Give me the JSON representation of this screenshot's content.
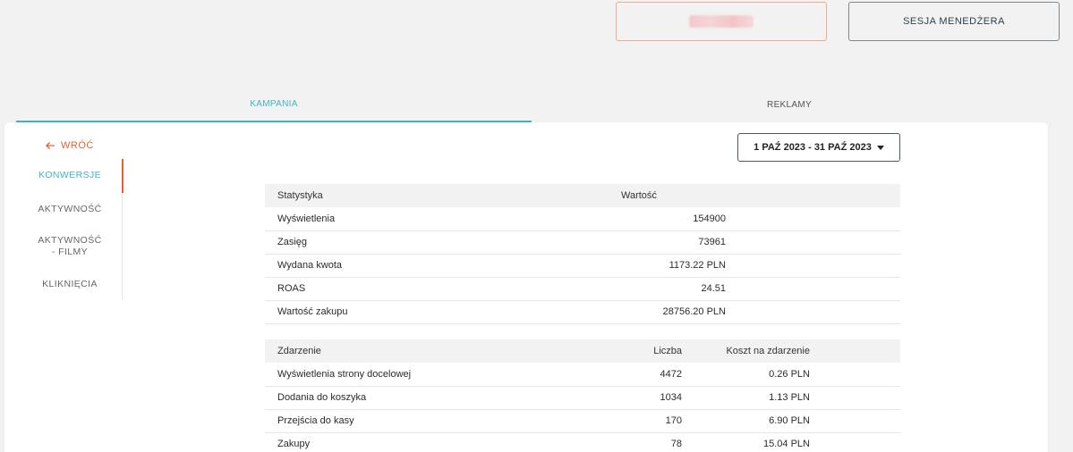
{
  "header": {
    "user_button_label": "",
    "manager_session_label": "SESJA MENEDŻERA"
  },
  "tabs": [
    {
      "label": "KAMPANIA",
      "active": true
    },
    {
      "label": "REKLAMY",
      "active": false
    }
  ],
  "back_label": "WRÓĆ",
  "side_nav": {
    "items": [
      {
        "label": "KONWERSJE",
        "active": true
      },
      {
        "label": "AKTYWNOŚĆ",
        "active": false
      },
      {
        "label": "AKTYWNOŚĆ - FILMY",
        "active": false
      },
      {
        "label": "KLIKNIĘCIA",
        "active": false
      }
    ]
  },
  "date_range": "1 PAŹ 2023 - 31 PAŹ 2023",
  "stats_table": {
    "headers": [
      "Statystyka",
      "Wartość"
    ],
    "rows": [
      [
        "Wyświetlenia",
        "154900"
      ],
      [
        "Zasięg",
        "73961"
      ],
      [
        "Wydana kwota",
        "1173.22 PLN"
      ],
      [
        "ROAS",
        "24.51"
      ],
      [
        "Wartość zakupu",
        "28756.20 PLN"
      ]
    ]
  },
  "events_table": {
    "headers": [
      "Zdarzenie",
      "Liczba",
      "Koszt na zdarzenie"
    ],
    "rows": [
      [
        "Wyświetlenia strony docelowej",
        "4472",
        "0.26 PLN"
      ],
      [
        "Dodania do koszyka",
        "1034",
        "1.13 PLN"
      ],
      [
        "Przejścia do kasy",
        "170",
        "6.90 PLN"
      ],
      [
        "Zakupy",
        "78",
        "15.04 PLN"
      ]
    ]
  },
  "colors": {
    "accent": "#3cb6c6",
    "orange": "#e2622f",
    "background": "#f2f2f2"
  }
}
